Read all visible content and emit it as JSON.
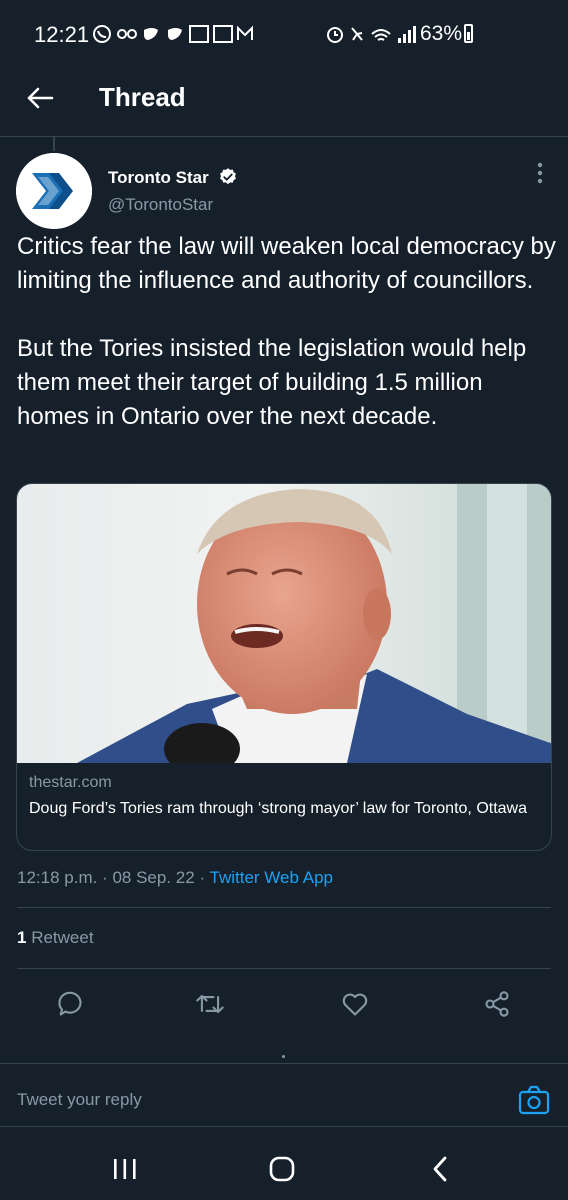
{
  "status_bar": {
    "time": "12:21",
    "battery": "63%"
  },
  "header": {
    "title": "Thread"
  },
  "tweet": {
    "author_name": "Toronto Star",
    "author_handle": "@TorontoStar",
    "paragraph_1": "Critics fear the law will weaken local democracy by limiting the influence and authority of councillors.",
    "paragraph_2": "But the Tories insisted the legislation would help them meet their target of building 1.5 million homes in Ontario over the next decade.",
    "card": {
      "domain": "thestar.com",
      "title": "Doug Ford’s Tories ram through ‘strong mayor’ law for Toronto, Ottawa"
    },
    "time": "12:18 p.m.",
    "date": "08 Sep. 22",
    "source": "Twitter Web App",
    "retweet_count": "1",
    "retweet_label": "Retweet"
  },
  "reply": {
    "placeholder": "Tweet your reply"
  },
  "colors": {
    "background": "#15202b",
    "accent": "#1da1f2",
    "secondary_text": "#8899a6",
    "divider": "#38444d"
  },
  "icons": {
    "back": "arrow-left-icon",
    "verified": "verified-badge-icon",
    "more": "more-vertical-icon",
    "reply": "comment-icon",
    "retweet": "retweet-icon",
    "like": "heart-icon",
    "share": "share-icon",
    "camera": "camera-icon"
  }
}
